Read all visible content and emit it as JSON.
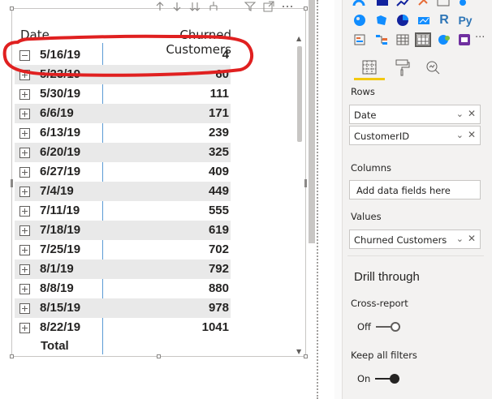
{
  "matrix": {
    "col_date": "Date",
    "col_churned": "Churned Customers",
    "rows": [
      {
        "date": "5/16/19",
        "value": "4",
        "expanded": true
      },
      {
        "date": "5/23/19",
        "value": "60",
        "expanded": false
      },
      {
        "date": "5/30/19",
        "value": "111",
        "expanded": false
      },
      {
        "date": "6/6/19",
        "value": "171",
        "expanded": false
      },
      {
        "date": "6/13/19",
        "value": "239",
        "expanded": false
      },
      {
        "date": "6/20/19",
        "value": "325",
        "expanded": false
      },
      {
        "date": "6/27/19",
        "value": "409",
        "expanded": false
      },
      {
        "date": "7/4/19",
        "value": "449",
        "expanded": false
      },
      {
        "date": "7/11/19",
        "value": "555",
        "expanded": false
      },
      {
        "date": "7/18/19",
        "value": "619",
        "expanded": false
      },
      {
        "date": "7/25/19",
        "value": "702",
        "expanded": false
      },
      {
        "date": "8/1/19",
        "value": "792",
        "expanded": false
      },
      {
        "date": "8/8/19",
        "value": "880",
        "expanded": false
      },
      {
        "date": "8/15/19",
        "value": "978",
        "expanded": false
      },
      {
        "date": "8/22/19",
        "value": "1041",
        "expanded": false
      }
    ],
    "total_label": "Total"
  },
  "viz_pane": {
    "r_label": "R",
    "py_label": "Py",
    "more_label": "···",
    "rows_label": "Rows",
    "rows_fields": [
      "Date",
      "CustomerID"
    ],
    "columns_label": "Columns",
    "columns_placeholder": "Add data fields here",
    "values_label": "Values",
    "values_fields": [
      "Churned Customers"
    ],
    "drill_through_title": "Drill through",
    "cross_report_label": "Cross-report",
    "cross_report_state": "Off",
    "keep_filters_label": "Keep all filters",
    "keep_filters_state": "On"
  },
  "colors": {
    "accent": "#f2c811",
    "separator": "#5b9bd5",
    "annotation": "#e02020",
    "row_shade": "#e9e9e9"
  }
}
